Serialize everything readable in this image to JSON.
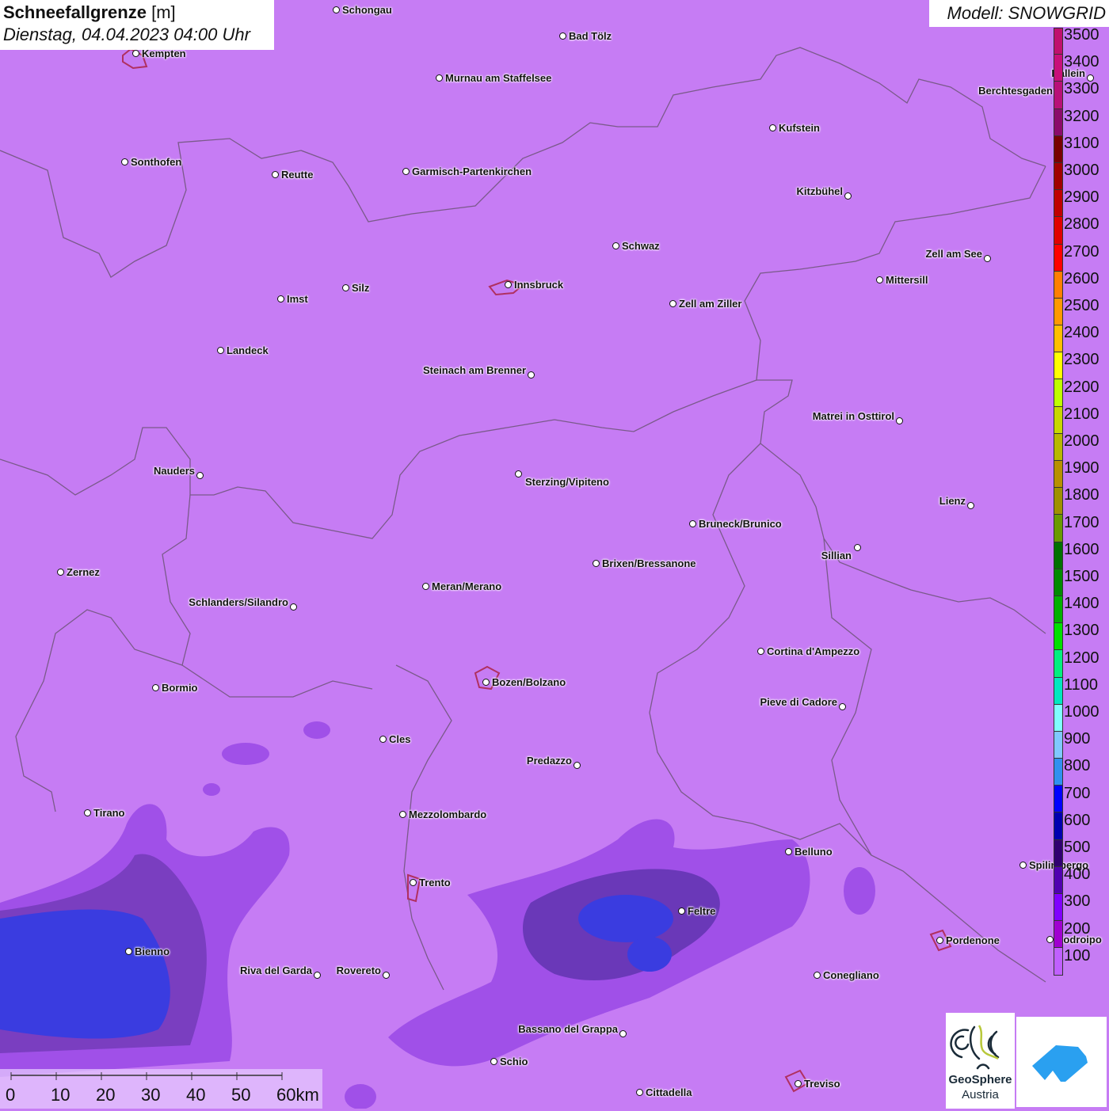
{
  "header": {
    "title_bold": "Schneefallgrenze",
    "title_unit": "[m]",
    "datetime": "Dienstag, 04.04.2023 04:00 Uhr",
    "model": "Modell: SNOWGRID"
  },
  "colors": {
    "background": "#c67cf4",
    "border": "#7a5a8a"
  },
  "legend": {
    "unit": "m",
    "items": [
      {
        "label": "3500",
        "color": "#c0106e"
      },
      {
        "label": "3400",
        "color": "#c8107a"
      },
      {
        "label": "3300",
        "color": "#b81078"
      },
      {
        "label": "3200",
        "color": "#8b0a6a"
      },
      {
        "label": "3100",
        "color": "#780000"
      },
      {
        "label": "3000",
        "color": "#a00000"
      },
      {
        "label": "2900",
        "color": "#c00000"
      },
      {
        "label": "2800",
        "color": "#e00000"
      },
      {
        "label": "2700",
        "color": "#ff0000"
      },
      {
        "label": "2600",
        "color": "#ff7f00"
      },
      {
        "label": "2500",
        "color": "#ff9900"
      },
      {
        "label": "2400",
        "color": "#ffbf00"
      },
      {
        "label": "2300",
        "color": "#ffff00"
      },
      {
        "label": "2200",
        "color": "#bfff00"
      },
      {
        "label": "2100",
        "color": "#c8d800"
      },
      {
        "label": "2000",
        "color": "#b8b800"
      },
      {
        "label": "1900",
        "color": "#b89000"
      },
      {
        "label": "1800",
        "color": "#a09000"
      },
      {
        "label": "1700",
        "color": "#6a9a00"
      },
      {
        "label": "1600",
        "color": "#007000"
      },
      {
        "label": "1500",
        "color": "#008a00"
      },
      {
        "label": "1400",
        "color": "#00b000"
      },
      {
        "label": "1300",
        "color": "#00e000"
      },
      {
        "label": "1200",
        "color": "#00f080"
      },
      {
        "label": "1100",
        "color": "#00e8c0"
      },
      {
        "label": "1000",
        "color": "#80ffff"
      },
      {
        "label": "900",
        "color": "#80c8ff"
      },
      {
        "label": "800",
        "color": "#3090f0"
      },
      {
        "label": "700",
        "color": "#0000ff"
      },
      {
        "label": "600",
        "color": "#0000b0"
      },
      {
        "label": "500",
        "color": "#300070"
      },
      {
        "label": "400",
        "color": "#5000b0"
      },
      {
        "label": "300",
        "color": "#8000ff"
      },
      {
        "label": "200",
        "color": "#a000d0"
      },
      {
        "label": "100",
        "color": "#c060ff"
      }
    ]
  },
  "cities": [
    {
      "name": "Schongau"
    },
    {
      "name": "Bad Tölz"
    },
    {
      "name": "Kempten"
    },
    {
      "name": "Murnau am Staffelsee"
    },
    {
      "name": "Hallein"
    },
    {
      "name": "Berchtesgaden"
    },
    {
      "name": "Kufstein"
    },
    {
      "name": "Sonthofen"
    },
    {
      "name": "Reutte"
    },
    {
      "name": "Garmisch-Partenkirchen"
    },
    {
      "name": "Kitzbühel"
    },
    {
      "name": "Schwaz"
    },
    {
      "name": "Zell am See"
    },
    {
      "name": "Mittersill"
    },
    {
      "name": "Innsbruck"
    },
    {
      "name": "Zell am Ziller"
    },
    {
      "name": "Silz"
    },
    {
      "name": "Imst"
    },
    {
      "name": "Landeck"
    },
    {
      "name": "Steinach am Brenner"
    },
    {
      "name": "Matrei in Osttirol"
    },
    {
      "name": "Nauders"
    },
    {
      "name": "Sterzing/Vipiteno"
    },
    {
      "name": "Lienz"
    },
    {
      "name": "Bruneck/Brunico"
    },
    {
      "name": "Sillian"
    },
    {
      "name": "Zernez"
    },
    {
      "name": "Brixen/Bressanone"
    },
    {
      "name": "Meran/Merano"
    },
    {
      "name": "Schlanders/Silandro"
    },
    {
      "name": "Cortina d'Ampezzo"
    },
    {
      "name": "Bozen/Bolzano"
    },
    {
      "name": "Bormio"
    },
    {
      "name": "Pieve di Cadore"
    },
    {
      "name": "Cles"
    },
    {
      "name": "Predazzo"
    },
    {
      "name": "Tirano"
    },
    {
      "name": "Mezzolombardo"
    },
    {
      "name": "Belluno"
    },
    {
      "name": "Spilimbergo"
    },
    {
      "name": "Trento"
    },
    {
      "name": "Feltre"
    },
    {
      "name": "Pordenone"
    },
    {
      "name": "Codroipo"
    },
    {
      "name": "Bienno"
    },
    {
      "name": "Riva del Garda"
    },
    {
      "name": "Rovereto"
    },
    {
      "name": "Conegliano"
    },
    {
      "name": "Bassano del Grappa"
    },
    {
      "name": "Schio"
    },
    {
      "name": "Treviso"
    },
    {
      "name": "Cittadella"
    }
  ],
  "scale": {
    "labels": [
      "0",
      "10",
      "20",
      "30",
      "40",
      "50",
      "60km"
    ]
  },
  "logos": {
    "geosphere_line1": "GeoSphere",
    "geosphere_line2": "Austria"
  }
}
